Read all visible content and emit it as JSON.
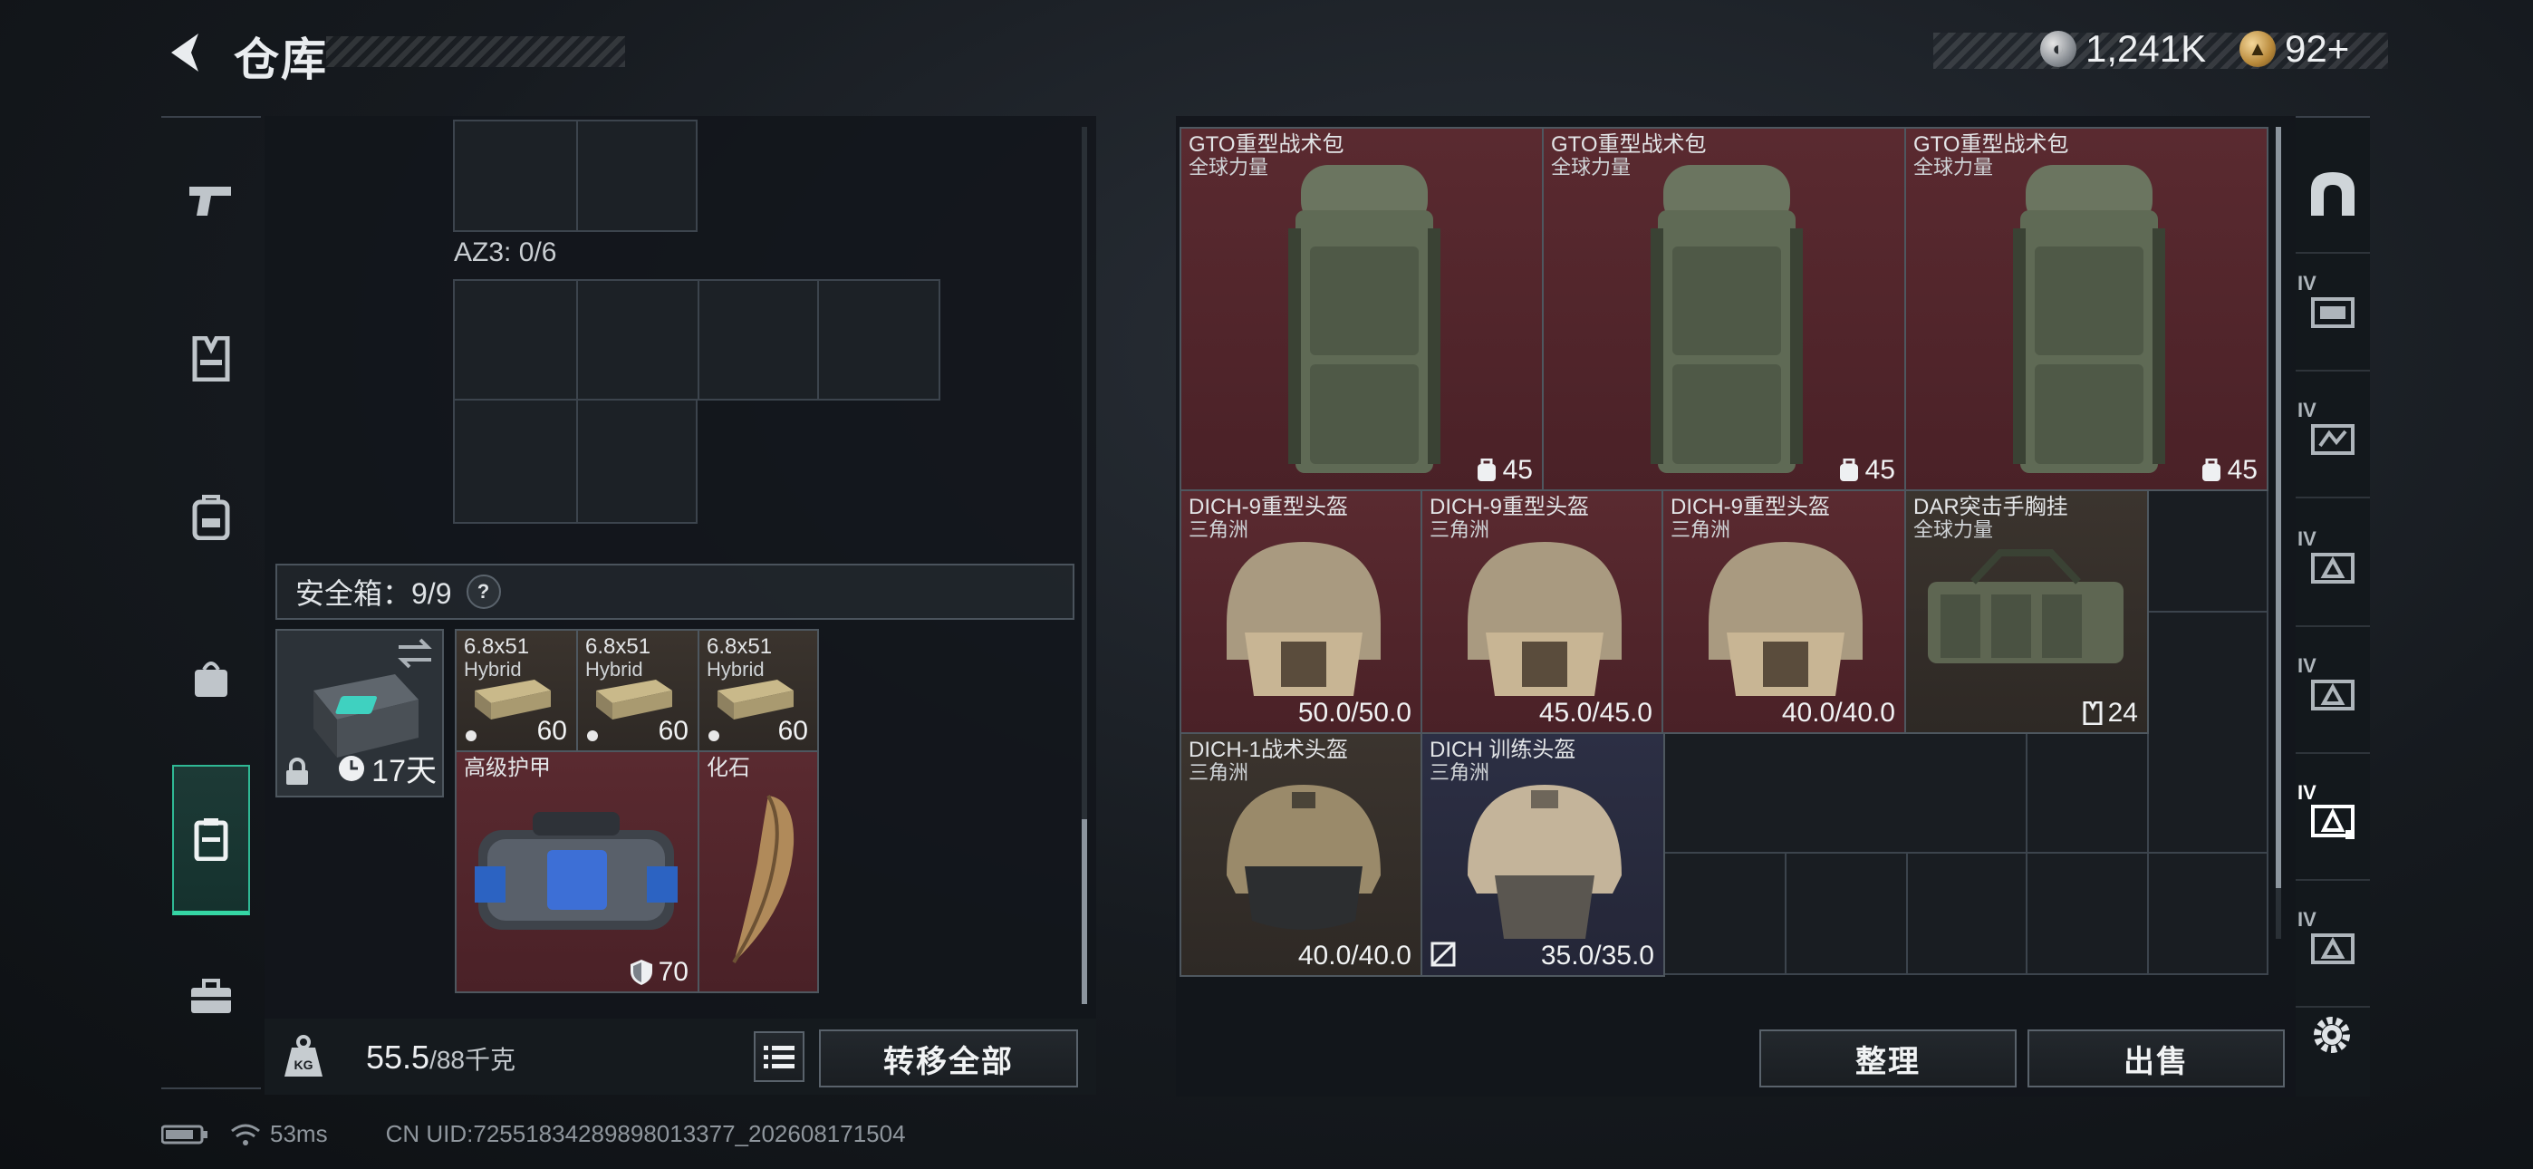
{
  "header": {
    "title": "仓库",
    "currency": {
      "silver_amount": "1,241K",
      "gold_amount": "92+"
    }
  },
  "left_nav": {
    "items": [
      "weapon-icon",
      "vest-icon",
      "backpack-icon",
      "pouch-icon",
      "container-icon",
      "toolbox-icon"
    ],
    "active_index": 4
  },
  "stash_left": {
    "az3_label": "AZ3: 0/6",
    "safe_box_label": "安全箱：9/9",
    "help_label": "?",
    "case_timer": "17天",
    "items": [
      {
        "name": "6.8x51",
        "sub": "Hybrid",
        "value": "60"
      },
      {
        "name": "6.8x51",
        "sub": "Hybrid",
        "value": "60"
      },
      {
        "name": "6.8x51",
        "sub": "Hybrid",
        "value": "60"
      },
      {
        "name": "高级护甲",
        "sub": "",
        "value": "70"
      },
      {
        "name": "化石",
        "sub": "",
        "value": ""
      }
    ],
    "weight_current": "55.5",
    "weight_max": "/88千克",
    "transfer_all_label": "转移全部"
  },
  "stash_right": {
    "items": [
      {
        "name": "GTO重型战术包",
        "sub": "全球力量",
        "value": "45"
      },
      {
        "name": "GTO重型战术包",
        "sub": "全球力量",
        "value": "45"
      },
      {
        "name": "GTO重型战术包",
        "sub": "全球力量",
        "value": "45"
      },
      {
        "name": "DICH-9重型头盔",
        "sub": "三角洲",
        "value": "50.0/50.0"
      },
      {
        "name": "DICH-9重型头盔",
        "sub": "三角洲",
        "value": "45.0/45.0"
      },
      {
        "name": "DICH-9重型头盔",
        "sub": "三角洲",
        "value": "40.0/40.0"
      },
      {
        "name": "DAR突击手胸挂",
        "sub": "全球力量",
        "value": "24"
      },
      {
        "name": "DICH-1战术头盔",
        "sub": "三角洲",
        "value": "40.0/40.0"
      },
      {
        "name": "DICH 训练头盔",
        "sub": "三角洲",
        "value": "35.0/35.0"
      }
    ],
    "sort_label": "整理",
    "sell_label": "出售"
  },
  "right_nav": {
    "items": [
      {
        "label": "",
        "icon": "arch-icon"
      },
      {
        "label": "IV",
        "icon": "stash-tab-icon"
      },
      {
        "label": "IV",
        "icon": "stash-tab-icon"
      },
      {
        "label": "IV",
        "icon": "stash-tab-icon"
      },
      {
        "label": "IV",
        "icon": "stash-tab-icon"
      },
      {
        "label": "IV",
        "icon": "stash-tab-icon"
      },
      {
        "label": "IV",
        "icon": "stash-tab-icon"
      }
    ],
    "active_index": 5
  },
  "status": {
    "ping": "53ms",
    "uid": "CN UID:72551834289898013377_202608171504"
  },
  "colors": {
    "accent": "#35d6a4",
    "rarity_red": "#5a2a30",
    "rarity_brown": "#3b342e",
    "rarity_navy": "#2c2f44"
  }
}
